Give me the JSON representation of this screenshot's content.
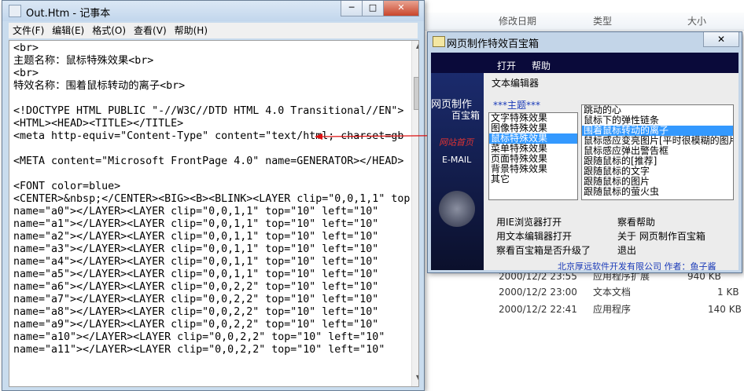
{
  "explorer": {
    "columns": [
      "修改日期",
      "类型",
      "大小"
    ],
    "rows": [
      {
        "date": "2000/12/2 23:55",
        "type": "应用程序扩展",
        "size": "940 KB"
      },
      {
        "date": "2000/12/2 23:00",
        "type": "文本文档",
        "size": "1 KB"
      },
      {
        "date": "2000/12/2 22:41",
        "type": "应用程序",
        "size": "140 KB"
      }
    ]
  },
  "notepad": {
    "title": "Out.Htm - 记事本",
    "menus": [
      "文件(F)",
      "编辑(E)",
      "格式(O)",
      "查看(V)",
      "帮助(H)"
    ],
    "content": "<br>\n主题名称：鼠标特殊效果<br>\n<br>\n特效名称：围着鼠标转动的离子<br>\n\n<!DOCTYPE HTML PUBLIC \"-//W3C//DTD HTML 4.0 Transitional//EN\">\n<HTML><HEAD><TITLE></TITLE>\n<meta http-equiv=\"Content-Type\" content=\"text/html; charset=gb\n\n<META content=\"Microsoft FrontPage 4.0\" name=GENERATOR></HEAD>\n\n<FONT color=blue>\n<CENTER>&nbsp;</CENTER><BIG><B><BLINK><LAYER clip=\"0,0,1,1\" top\nname=\"a0\"></LAYER><LAYER clip=\"0,0,1,1\" top=\"10\" left=\"10\"\nname=\"a1\"></LAYER><LAYER clip=\"0,0,1,1\" top=\"10\" left=\"10\"\nname=\"a2\"></LAYER><LAYER clip=\"0,0,1,1\" top=\"10\" left=\"10\"\nname=\"a3\"></LAYER><LAYER clip=\"0,0,1,1\" top=\"10\" left=\"10\"\nname=\"a4\"></LAYER><LAYER clip=\"0,0,1,1\" top=\"10\" left=\"10\"\nname=\"a5\"></LAYER><LAYER clip=\"0,0,1,1\" top=\"10\" left=\"10\"\nname=\"a6\"></LAYER><LAYER clip=\"0,0,2,2\" top=\"10\" left=\"10\"\nname=\"a7\"></LAYER><LAYER clip=\"0,0,2,2\" top=\"10\" left=\"10\"\nname=\"a8\"></LAYER><LAYER clip=\"0,0,2,2\" top=\"10\" left=\"10\"\nname=\"a9\"></LAYER><LAYER clip=\"0,0,2,2\" top=\"10\" left=\"10\"\nname=\"a10\"></LAYER><LAYER clip=\"0,0,2,2\" top=\"10\" left=\"10\"\nname=\"a11\"></LAYER><LAYER clip=\"0,0,2,2\" top=\"10\" left=\"10\""
  },
  "baobox": {
    "title": "网页制作特效百宝箱",
    "menus": [
      "打开",
      "帮助"
    ],
    "left_nav": [
      "网页制作",
      "百宝箱",
      "网站首页",
      "E-MAIL"
    ],
    "panel_title": "文本编辑器",
    "category_header": "***主题***",
    "categories": [
      "文字特殊效果",
      "图像特殊效果",
      "鼠标特殊效果",
      "菜单特殊效果",
      "页面特殊效果",
      "背景特殊效果",
      "其它"
    ],
    "selected_category": 2,
    "effects": [
      "跳动的心",
      "鼠标下的弹性链条",
      "围着鼠标转动的离子",
      "鼠标感应变亮图片[平时很模糊的图片",
      "鼠标感应弹出警告框",
      "跟随鼠标的[推荐]",
      "跟随鼠标的文字",
      "跟随鼠标的图片",
      "跟随鼠标的萤火虫"
    ],
    "selected_effect": 2,
    "options_left": [
      "用IE浏览器打开",
      "用文本编辑器打开",
      "察看百宝箱是否升级了"
    ],
    "options_right": [
      "察看帮助",
      "关于 网页制作百宝箱",
      "退出"
    ],
    "footer": "北京厚远软件开发有限公司  作者：鱼子酱"
  },
  "colors": {
    "selection": "#3399ff",
    "annotation": "#dd1111"
  }
}
